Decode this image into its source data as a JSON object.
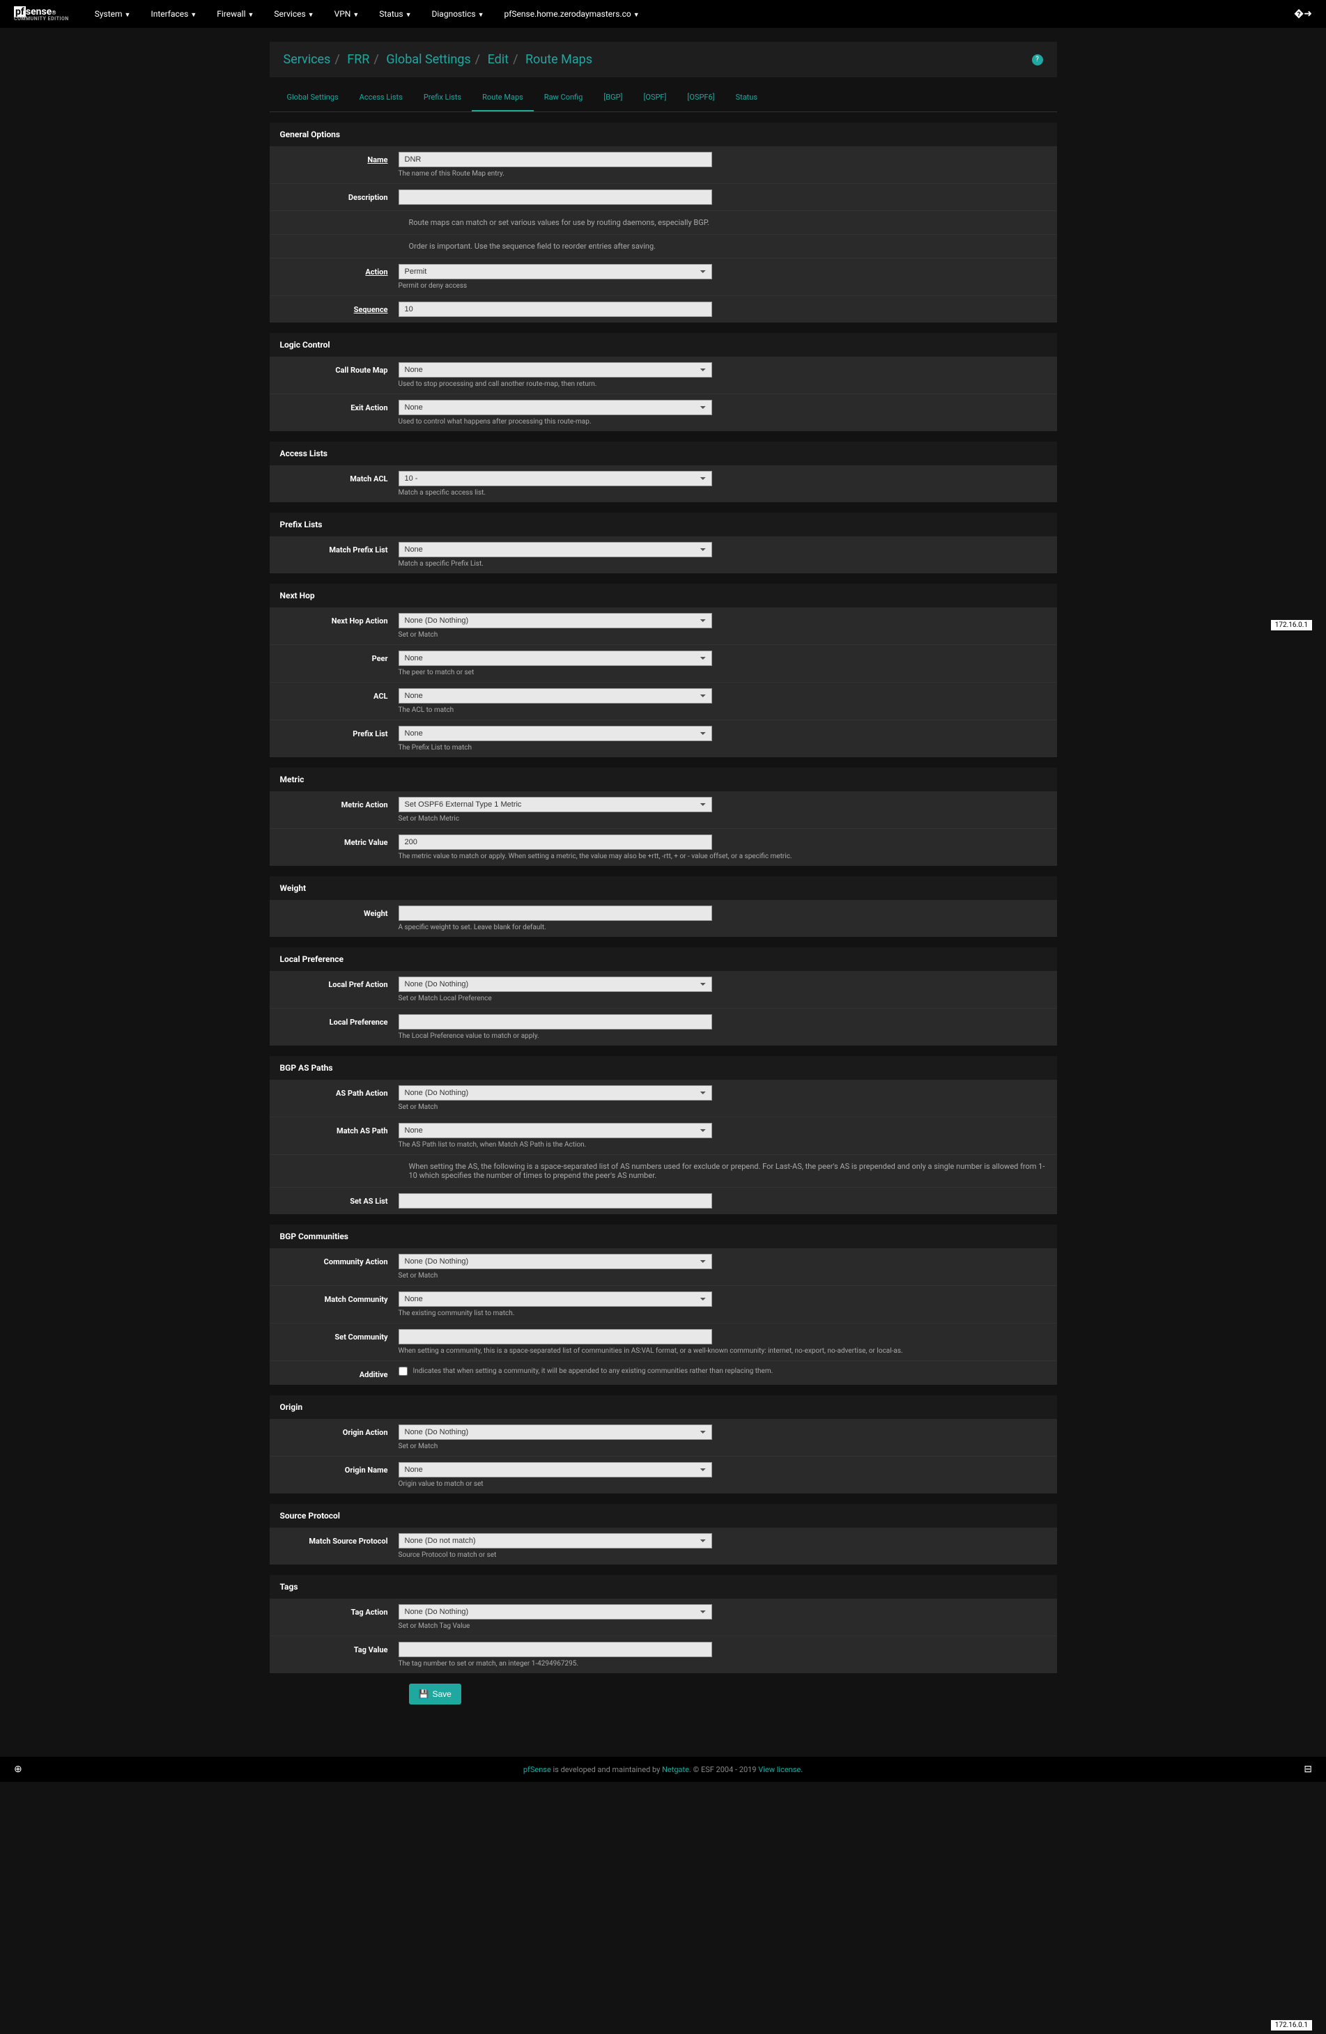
{
  "nav": {
    "brand": "pfsense",
    "brand_sub": "COMMUNITY EDITION",
    "items": [
      "System",
      "Interfaces",
      "Firewall",
      "Services",
      "VPN",
      "Status",
      "Diagnostics"
    ],
    "host": "pfSense.home.zerodaymasters.co"
  },
  "breadcrumb": [
    "Services",
    "FRR",
    "Global Settings",
    "Edit",
    "Route Maps"
  ],
  "tabs": [
    "Global Settings",
    "Access Lists",
    "Prefix Lists",
    "Route Maps",
    "Raw Config",
    "[BGP]",
    "[OSPF]",
    "[OSPF6]",
    "Status"
  ],
  "active_tab": "Route Maps",
  "sections": {
    "general": {
      "title": "General Options",
      "name_label": "Name",
      "name_value": "DNR",
      "name_help": "The name of this Route Map entry.",
      "desc_label": "Description",
      "desc_value": "",
      "info1": "Route maps can match or set various values for use by routing daemons, especially BGP.",
      "info2": "Order is important. Use the sequence field to reorder entries after saving.",
      "action_label": "Action",
      "action_value": "Permit",
      "action_help": "Permit or deny access",
      "seq_label": "Sequence",
      "seq_value": "10"
    },
    "logic": {
      "title": "Logic Control",
      "call_label": "Call Route Map",
      "call_value": "None",
      "call_help": "Used to stop processing and call another route-map, then return.",
      "exit_label": "Exit Action",
      "exit_value": "None",
      "exit_help": "Used to control what happens after processing this route-map."
    },
    "acl": {
      "title": "Access Lists",
      "match_label": "Match ACL",
      "match_value": "10 -",
      "match_help": "Match a specific access list."
    },
    "prefix": {
      "title": "Prefix Lists",
      "match_label": "Match Prefix List",
      "match_value": "None",
      "match_help": "Match a specific Prefix List."
    },
    "nexthop": {
      "title": "Next Hop",
      "action_label": "Next Hop Action",
      "action_value": "None (Do Nothing)",
      "action_help": "Set or Match",
      "peer_label": "Peer",
      "peer_value": "None",
      "peer_help": "The peer to match or set",
      "acl_label": "ACL",
      "acl_value": "None",
      "acl_help": "The ACL to match",
      "pl_label": "Prefix List",
      "pl_value": "None",
      "pl_help": "The Prefix List to match"
    },
    "metric": {
      "title": "Metric",
      "action_label": "Metric Action",
      "action_value": "Set OSPF6 External Type 1 Metric",
      "action_help": "Set or Match Metric",
      "value_label": "Metric Value",
      "value_value": "200",
      "value_help": "The metric value to match or apply. When setting a metric, the value may also be +rtt, -rtt, + or - value offset, or a specific metric."
    },
    "weight": {
      "title": "Weight",
      "label": "Weight",
      "value": "",
      "help": "A specific weight to set. Leave blank for default."
    },
    "localpref": {
      "title": "Local Preference",
      "action_label": "Local Pref Action",
      "action_value": "None (Do Nothing)",
      "action_help": "Set or Match Local Preference",
      "value_label": "Local Preference",
      "value_value": "",
      "value_help": "The Local Preference value to match or apply."
    },
    "aspath": {
      "title": "BGP AS Paths",
      "action_label": "AS Path Action",
      "action_value": "None (Do Nothing)",
      "action_help": "Set or Match",
      "match_label": "Match AS Path",
      "match_value": "None",
      "match_help": "The AS Path list to match, when Match AS Path is the Action.",
      "info": "When setting the AS, the following is a space-separated list of AS numbers used for exclude or prepend. For Last-AS, the peer's AS is prepended and only a single number is allowed from 1-10 which specifies the number of times to prepend the peer's AS number.",
      "set_label": "Set AS List",
      "set_value": ""
    },
    "comm": {
      "title": "BGP Communities",
      "action_label": "Community Action",
      "action_value": "None (Do Nothing)",
      "action_help": "Set or Match",
      "match_label": "Match Community",
      "match_value": "None",
      "match_help": "The existing community list to match.",
      "set_label": "Set Community",
      "set_value": "",
      "set_help": "When setting a community, this is a space-separated list of communities in AS:VAL format, or a well-known community: internet, no-export, no-advertise, or local-as.",
      "add_label": "Additive",
      "add_help": "Indicates that when setting a community, it will be appended to any existing communities rather than replacing them."
    },
    "origin": {
      "title": "Origin",
      "action_label": "Origin Action",
      "action_value": "None (Do Nothing)",
      "action_help": "Set or Match",
      "name_label": "Origin Name",
      "name_value": "None",
      "name_help": "Origin value to match or set"
    },
    "source": {
      "title": "Source Protocol",
      "label": "Match Source Protocol",
      "value": "None (Do not match)",
      "help": "Source Protocol to match or set"
    },
    "tags": {
      "title": "Tags",
      "action_label": "Tag Action",
      "action_value": "None (Do Nothing)",
      "action_help": "Set or Match Tag Value",
      "value_label": "Tag Value",
      "value_value": "",
      "value_help": "The tag number to set or match, an integer 1-4294967295."
    }
  },
  "save_label": "Save",
  "footer": {
    "text1": "pfSense",
    "text2": " is developed and maintained by ",
    "link1": "Netgate.",
    "text3": " © ESF 2004 - 2019 ",
    "link2": "View license."
  },
  "ip": "172.16.0.1"
}
